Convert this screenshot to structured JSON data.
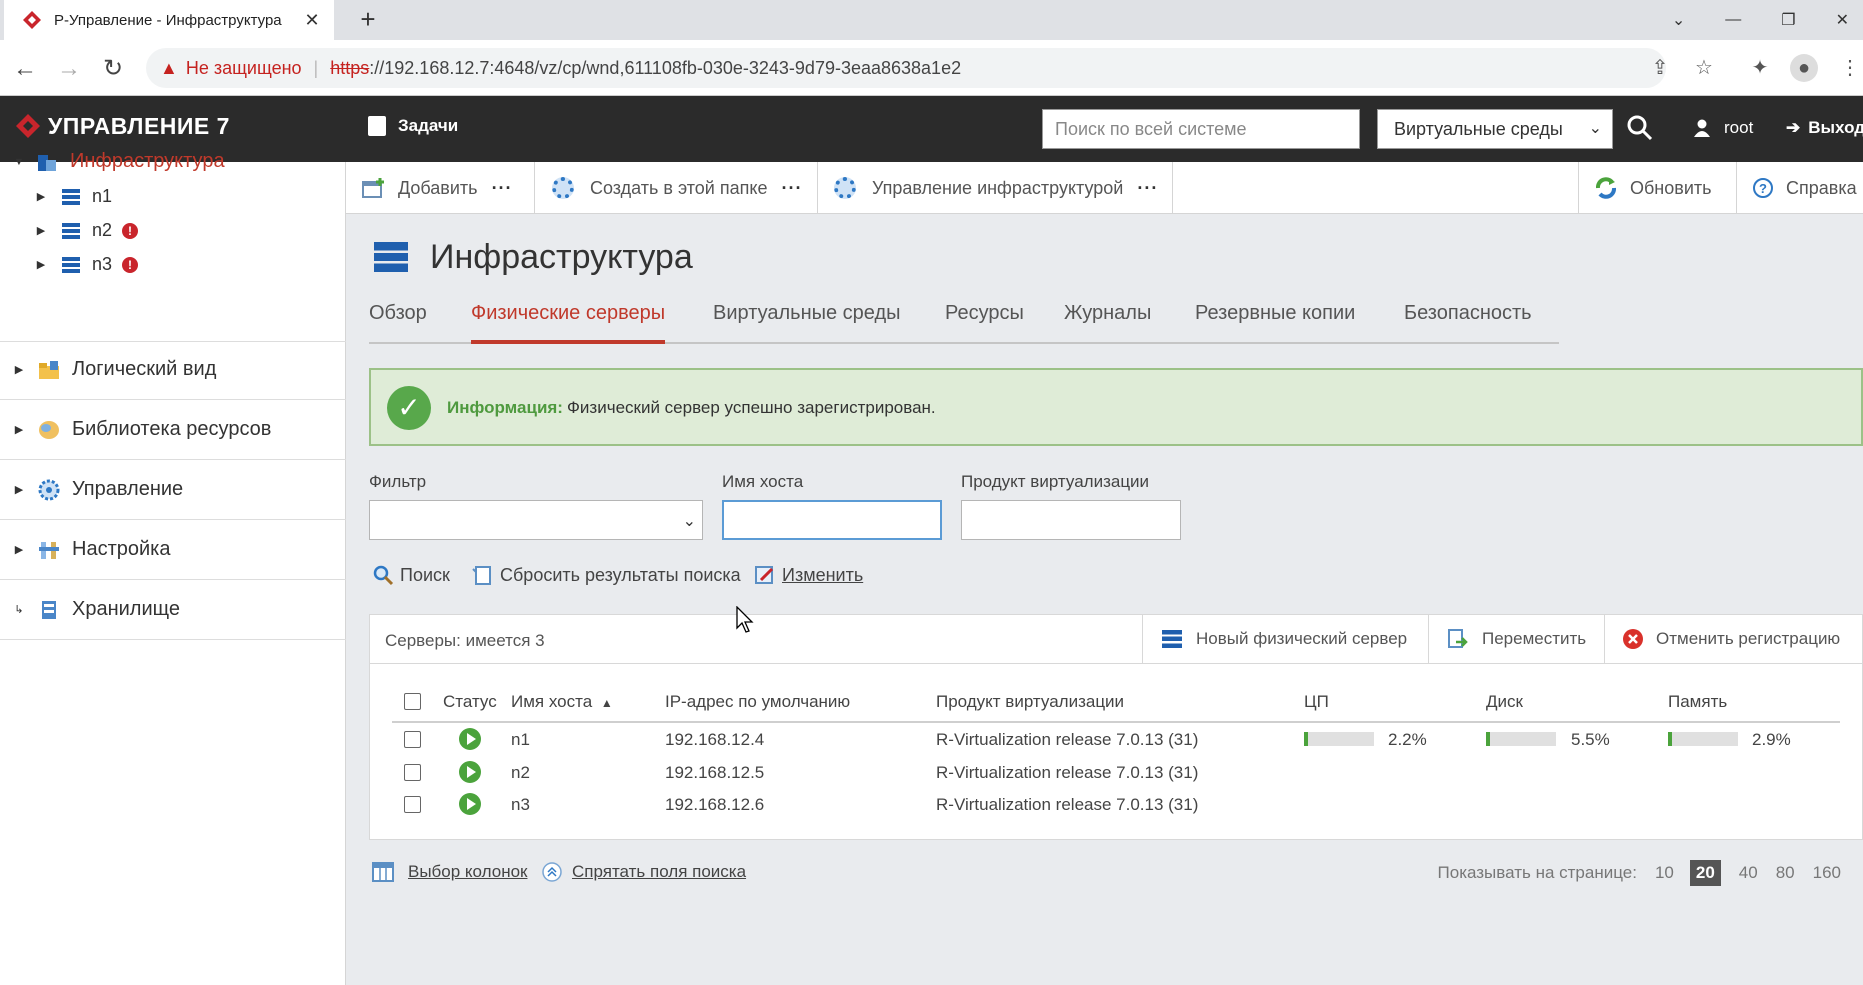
{
  "browser": {
    "tab_title": "Р-Управление - Инфраструктура",
    "tab_close": "✕",
    "new_tab": "+",
    "security_label": "Не защищено",
    "url_protocol": "https",
    "url_rest": "://192.168.12.7:4648/vz/cp/wnd,611108fb-030e-3243-9d79-3eaa8638a1e2"
  },
  "header": {
    "brand": "УПРАВЛЕНИЕ 7",
    "tasks": "Задачи",
    "search_placeholder": "Поиск по всей системе",
    "scope_select": "Виртуальные среды",
    "user": "root",
    "logout": "Выход"
  },
  "sidebar": {
    "infrastructure": "Инфраструктура",
    "nodes": [
      {
        "name": "n1",
        "error": false
      },
      {
        "name": "n2",
        "error": true
      },
      {
        "name": "n3",
        "error": true
      }
    ],
    "sections": [
      "Логический вид",
      "Библиотека ресурсов",
      "Управление",
      "Настройка",
      "Хранилище"
    ]
  },
  "toolbar": {
    "add": "Добавить",
    "create_in_folder": "Создать в этой папке",
    "manage_infra": "Управление инфраструктурой",
    "refresh": "Обновить",
    "help": "Справка",
    "more": "···"
  },
  "page": {
    "title": "Инфраструктура",
    "tabs": [
      "Обзор",
      "Физические серверы",
      "Виртуальные среды",
      "Ресурсы",
      "Журналы",
      "Резервные копии",
      "Безопасность"
    ],
    "active_tab": "Физические серверы"
  },
  "info": {
    "label": "Информация:",
    "message": "Физический сервер успешно зарегистрирован."
  },
  "filters": {
    "filter_label": "Фильтр",
    "hostname_label": "Имя хоста",
    "product_label": "Продукт виртуализации",
    "filter_value": "",
    "hostname_value": "",
    "product_value": ""
  },
  "actions": {
    "search": "Поиск",
    "reset": "Сбросить результаты поиска",
    "edit": "Изменить"
  },
  "grid": {
    "count": "Серверы: имеется 3",
    "new_server": "Новый физический сервер",
    "move": "Переместить",
    "unregister": "Отменить регистрацию",
    "columns": [
      "Статус",
      "Имя хоста",
      "IP-адрес по умолчанию",
      "Продукт виртуализации",
      "ЦП",
      "Диск",
      "Память"
    ],
    "sort_indicator": "▲",
    "rows": [
      {
        "host": "n1",
        "ip": "192.168.12.4",
        "product": "R-Virtualization release 7.0.13 (31)",
        "cpu": "2.2%",
        "disk": "5.5%",
        "mem": "2.9%",
        "cpu_frac": 0.022,
        "disk_frac": 0.055,
        "mem_frac": 0.029
      },
      {
        "host": "n2",
        "ip": "192.168.12.5",
        "product": "R-Virtualization release 7.0.13 (31)"
      },
      {
        "host": "n3",
        "ip": "192.168.12.6",
        "product": "R-Virtualization release 7.0.13 (31)"
      }
    ]
  },
  "footer": {
    "columns_choice": "Выбор колонок",
    "hide_search": "Спрятать поля поиска",
    "per_page_label": "Показывать на странице:",
    "page_sizes": [
      "10",
      "20",
      "40",
      "80",
      "160"
    ],
    "active_page_size": "20"
  },
  "colors": {
    "accent": "#c0392b",
    "header_bg": "#2b2b2b",
    "success": "#4ba33c",
    "error": "#c9252c",
    "link_blue": "#1f5fae"
  }
}
